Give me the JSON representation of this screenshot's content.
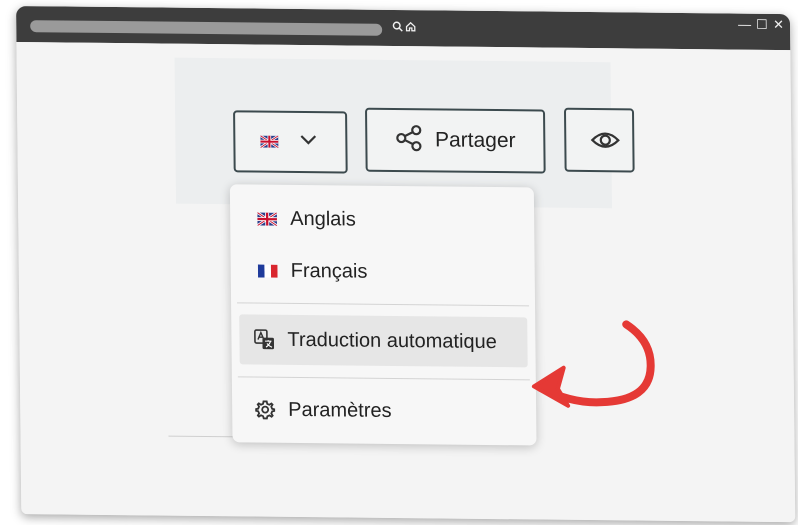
{
  "browser": {
    "controls": {
      "minimize": "—",
      "maximize": "☐",
      "close": "✕"
    }
  },
  "toolbar": {
    "language_button": {
      "flag": "gb-flag-icon",
      "chevron": "chevron-down-icon"
    },
    "share_button": {
      "icon": "share-icon",
      "label": "Partager"
    },
    "view_button": {
      "icon": "eye-icon"
    }
  },
  "language_menu": {
    "items": [
      {
        "icon": "gb-flag-icon",
        "label": "Anglais"
      },
      {
        "icon": "fr-flag-icon",
        "label": "Français"
      },
      {
        "icon": "translate-icon",
        "label": "Traduction automatique",
        "highlighted": true
      },
      {
        "icon": "gear-icon",
        "label": "Paramètres"
      }
    ]
  },
  "annotation": {
    "arrow_color": "#e53935"
  }
}
